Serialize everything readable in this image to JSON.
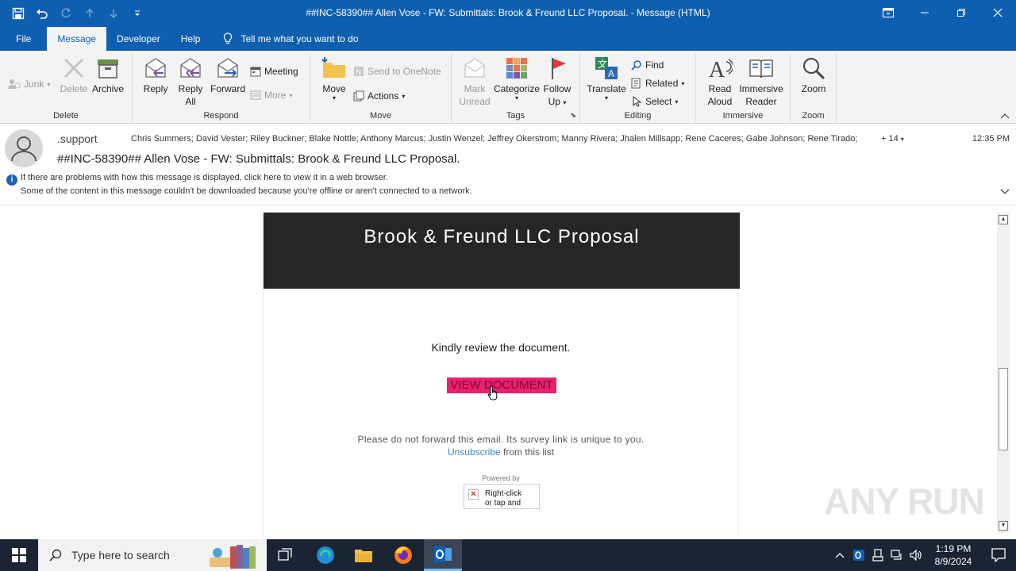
{
  "window": {
    "title": "##INC-58390## Allen Vose - FW: Submittals: Brook & Freund LLC Proposal.  -  Message (HTML)"
  },
  "menu": {
    "tabs": [
      "File",
      "Message",
      "Developer",
      "Help"
    ],
    "active_tab": "Message",
    "tell_me": "Tell me what you want to do"
  },
  "ribbon": {
    "delete_group": {
      "label": "Delete",
      "junk": "Junk",
      "delete": "Delete",
      "archive": "Archive"
    },
    "respond_group": {
      "label": "Respond",
      "reply": "Reply",
      "reply_all_1": "Reply",
      "reply_all_2": "All",
      "forward": "Forward",
      "meeting": "Meeting",
      "more": "More"
    },
    "move_group": {
      "label": "Move",
      "move": "Move",
      "send_onenote": "Send to OneNote",
      "actions": "Actions"
    },
    "tags_group": {
      "label": "Tags",
      "mark_unread_1": "Mark",
      "mark_unread_2": "Unread",
      "categorize": "Categorize",
      "follow_up_1": "Follow",
      "follow_up_2": "Up"
    },
    "editing_group": {
      "label": "Editing",
      "translate": "Translate",
      "find": "Find",
      "related": "Related",
      "select": "Select"
    },
    "immersive_group": {
      "label": "Immersive",
      "read_aloud_1": "Read",
      "read_aloud_2": "Aloud",
      "immersive_reader_1": "Immersive",
      "immersive_reader_2": "Reader"
    },
    "zoom_group": {
      "label": "Zoom",
      "zoom": "Zoom"
    }
  },
  "message": {
    "sender": ".support",
    "recipients": "Chris Summers; David Vester; Riley Buckner; Blake Nottle; Anthony Marcus; Justin Wenzel; Jeffrey Okerstrom; Manny Rivera; Jhalen Millsapp; Rene Caceres; Gabe Johnson; Rene Tirado;",
    "more_recipients": "+ 14",
    "time": "12:35 PM",
    "subject": "##INC-58390## Allen Vose - FW: Submittals: Brook & Freund LLC Proposal.",
    "info_line_1": "If there are problems with how this message is displayed, click here to view it in a web browser.",
    "info_line_2": "Some of the content in this message couldn't be downloaded because you're offline or aren't connected to a network."
  },
  "email_body": {
    "banner_title": "Brook & Freund LLC Proposal",
    "kindly": "Kindly review the document.",
    "view_button": "VIEW DOCUMENT",
    "forward_note": "Please do not forward this email. Its survey link is unique to you.",
    "unsubscribe_link": "Unsubscribe",
    "unsubscribe_rest": " from this list",
    "powered_by": "Powered by",
    "broken_image_text_1": "Right-click",
    "broken_image_text_2": "or tap and"
  },
  "watermark": "ANY RUN",
  "taskbar": {
    "search_placeholder": "Type here to search",
    "time": "1:19 PM",
    "date": "8/9/2024"
  },
  "colors": {
    "titlebar": "#0f5fb0",
    "banner": "#262626",
    "view_button": "#e8216c",
    "link": "#3b86c9",
    "taskbar": "#1a2433"
  }
}
